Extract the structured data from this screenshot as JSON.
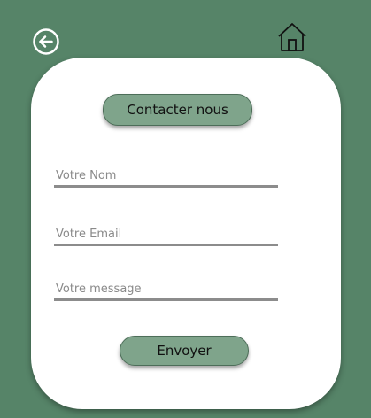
{
  "header": {
    "back_icon": "arrow-left-circle-icon",
    "home_icon": "home-icon"
  },
  "form": {
    "title": "Contacter nous",
    "name_placeholder": "Votre Nom",
    "email_placeholder": "Votre Email",
    "message_placeholder": "Votre message",
    "submit_label": "Envoyer"
  },
  "colors": {
    "background": "#568468",
    "card": "#ffffff",
    "button": "#7fa48b",
    "underline": "#8c8c8c"
  }
}
